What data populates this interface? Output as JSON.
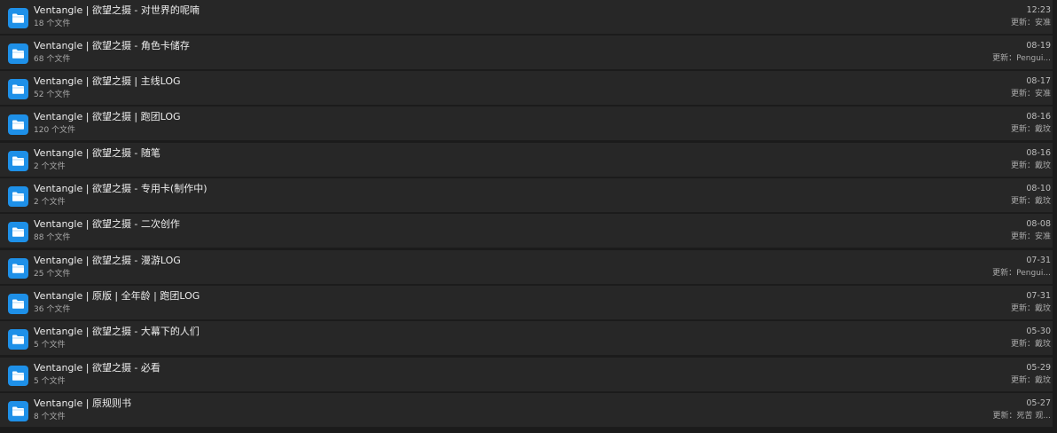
{
  "folders": [
    {
      "name": "Ventangle | 欲望之摄 - 对世界的呢喃",
      "count": "18 个文件",
      "date": "12:23",
      "updater": "更新：安准"
    },
    {
      "name": "Ventangle | 欲望之摄 - 角色卡储存",
      "count": "68 个文件",
      "date": "08-19",
      "updater": "更新：Pengui..."
    },
    {
      "name": "Ventangle | 欲望之摄 | 主线LOG",
      "count": "52 个文件",
      "date": "08-17",
      "updater": "更新：安准"
    },
    {
      "name": "Ventangle | 欲望之摄 | 跑团LOG",
      "count": "120 个文件",
      "date": "08-16",
      "updater": "更新：戴玟"
    },
    {
      "name": "Ventangle | 欲望之摄 - 随笔",
      "count": "2 个文件",
      "date": "08-16",
      "updater": "更新：戴玟"
    },
    {
      "name": "Ventangle | 欲望之摄 - 专用卡(制作中)",
      "count": "2 个文件",
      "date": "08-10",
      "updater": "更新：戴玟"
    },
    {
      "name": "Ventangle | 欲望之摄 - 二次创作",
      "count": "88 个文件",
      "date": "08-08",
      "updater": "更新：安准"
    },
    {
      "name": "Ventangle | 欲望之摄 - 漫游LOG",
      "count": "25 个文件",
      "date": "07-31",
      "updater": "更新：Pengui..."
    },
    {
      "name": "Ventangle | 原版 | 全年龄 | 跑团LOG",
      "count": "36 个文件",
      "date": "07-31",
      "updater": "更新：戴玟"
    },
    {
      "name": "Ventangle | 欲望之摄 - 大幕下的人们",
      "count": "5 个文件",
      "date": "05-30",
      "updater": "更新：戴玟"
    },
    {
      "name": "Ventangle | 欲望之摄 - 必看",
      "count": "5 个文件",
      "date": "05-29",
      "updater": "更新：戴玟"
    },
    {
      "name": "Ventangle | 原规则书",
      "count": "8 个文件",
      "date": "05-27",
      "updater": "更新：死苦 观..."
    }
  ],
  "colors": {
    "background": "#1b1b1b",
    "row": "#272727",
    "icon_accent": "#1e90e8"
  },
  "icons": {
    "folder": "folder-icon"
  }
}
